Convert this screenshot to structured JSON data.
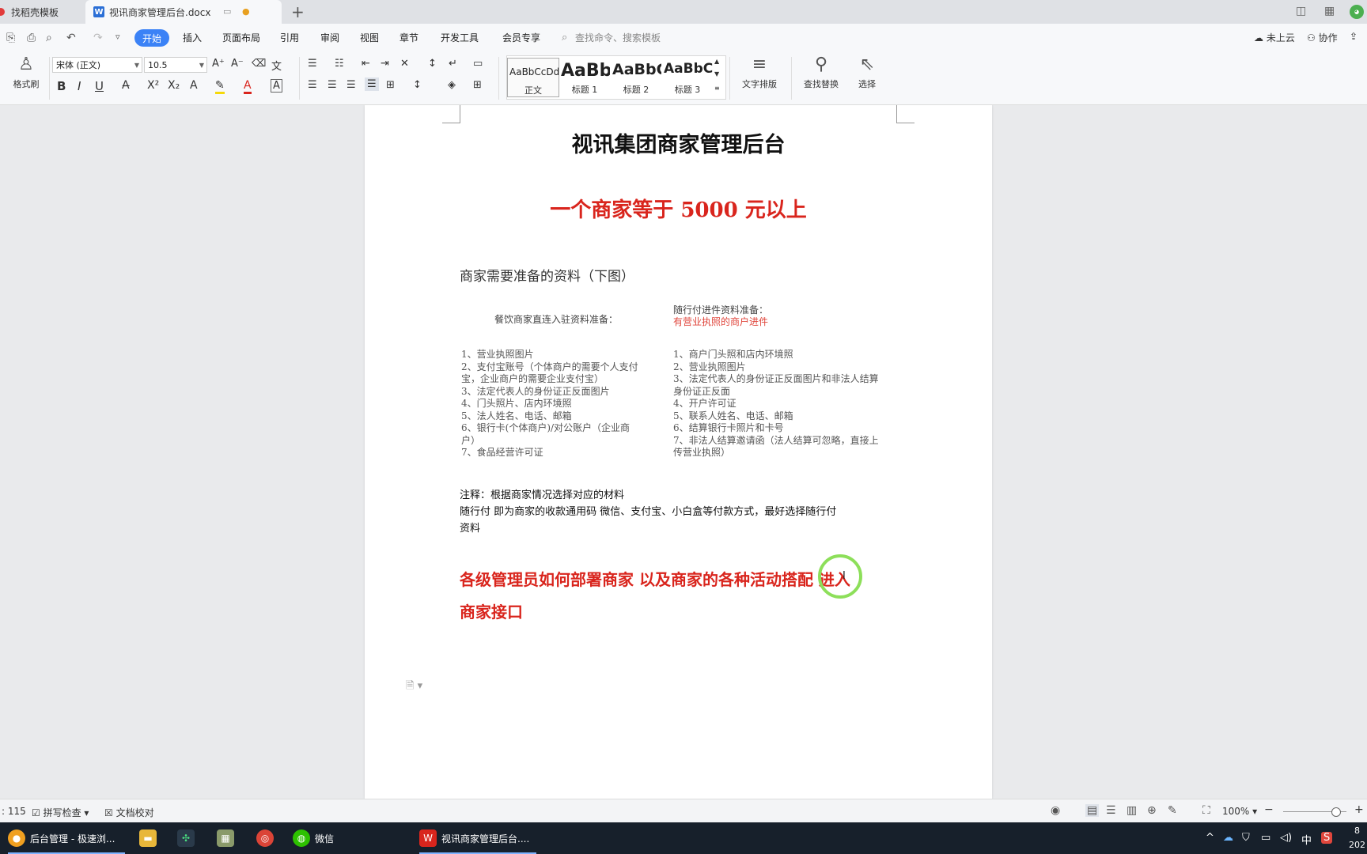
{
  "tabs": {
    "templates": "找稻壳模板",
    "doc_title": "视讯商家管理后台.docx"
  },
  "menu": {
    "start": "开始",
    "items": [
      "插入",
      "页面布局",
      "引用",
      "审阅",
      "视图",
      "章节",
      "开发工具",
      "会员专享"
    ],
    "search_placeholder": "查找命令、搜索模板",
    "cloud": "未上云",
    "collab": "协作"
  },
  "ribbon": {
    "format_painter": "格式刷",
    "font_name": "宋体 (正文)",
    "font_size": "10.5",
    "styles": [
      {
        "preview": "AaBbCcDd",
        "name": "正文"
      },
      {
        "preview": "AaBb",
        "name": "标题 1"
      },
      {
        "preview": "AaBbC",
        "name": "标题 2"
      },
      {
        "preview": "AaBbC",
        "name": "标题 3"
      }
    ],
    "text_layout": "文字排版",
    "find_replace": "查找替换",
    "select": "选择"
  },
  "document": {
    "title": "视讯集团商家管理后台",
    "headline": "一个商家等于 5000 元以上",
    "materials_heading": "商家需要准备的资料（下图）",
    "left_col_head": "餐饮商家直连入驻资料准备：",
    "right_col_head": "随行付进件资料准备：",
    "right_col_sub": "有营业执照的商户进件",
    "left_list": [
      "1、营业执照图片",
      "2、支付宝账号（个体商户的需要个人支付",
      "宝，企业商户的需要企业支付宝）",
      "3、法定代表人的身份证正反面图片",
      "4、门头照片、店内环境照",
      "5、法人姓名、电话、邮箱",
      "6、银行卡(个体商户)/对公账户（企业商",
      "户）",
      "7、食品经营许可证"
    ],
    "right_list": [
      "1、商户门头照和店内环境照",
      "2、营业执照图片",
      "3、法定代表人的身份证正反面图片和非法人结算",
      "身份证正反面",
      "4、开户许可证",
      "5、联系人姓名、电话、邮箱",
      "6、结算银行卡照片和卡号",
      "7、非法人结算邀请函（法人结算可忽略，直接上",
      "传营业执照）"
    ],
    "note_1": "注释：根据商家情况选择对应的材料",
    "note_2": "随行付 即为商家的收款通用码 微信、支付宝、小白盒等付款方式，最好选择随行付",
    "note_3": "资料",
    "admin_line_1": "各级管理员如何部署商家  以及商家的各种活动搭配  进入",
    "admin_line_2": "商家接口"
  },
  "status": {
    "word_count": ": 115",
    "spell_check": "拼写检查",
    "doc_proof": "文档校对",
    "zoom": "100%",
    "zoom_level": 0.82
  },
  "taskbar": {
    "browser_app": "后台管理 - 极速浏...",
    "wechat": "微信",
    "wps_doc": "视讯商家管理后台....",
    "ime": "中",
    "clock_top": "8",
    "clock_bottom": "202"
  }
}
